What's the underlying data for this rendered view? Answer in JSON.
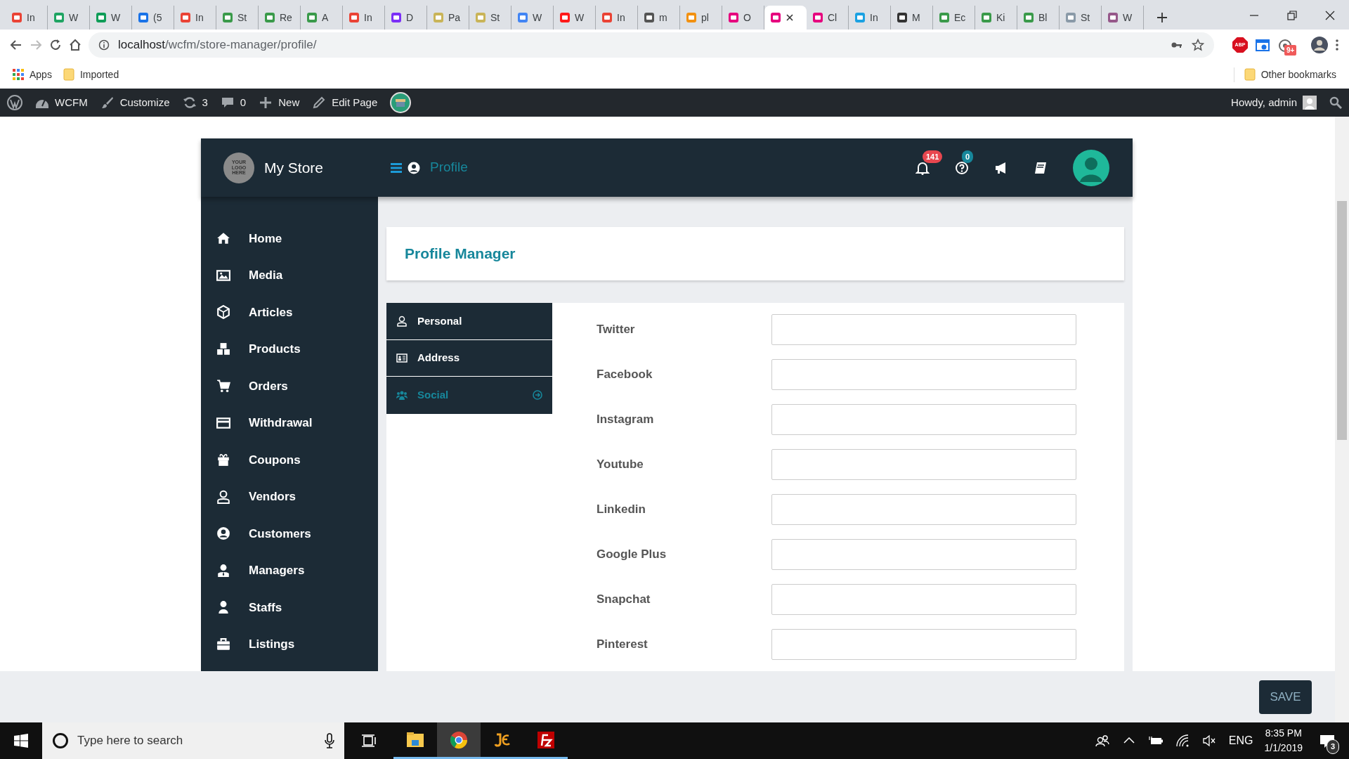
{
  "browser": {
    "tabs": [
      {
        "title": "In",
        "color": "#ea4335",
        "selected": false
      },
      {
        "title": "W",
        "color": "#1fa463",
        "selected": false
      },
      {
        "title": "W",
        "color": "#0f9d58",
        "selected": false
      },
      {
        "title": "(5",
        "color": "#1a73e8",
        "selected": false
      },
      {
        "title": "In",
        "color": "#ea4335",
        "selected": false
      },
      {
        "title": "St",
        "color": "#3a9a4a",
        "selected": false
      },
      {
        "title": "Re",
        "color": "#3a9a4a",
        "selected": false
      },
      {
        "title": "A",
        "color": "#3a9a4a",
        "selected": false
      },
      {
        "title": "In",
        "color": "#ea4335",
        "selected": false
      },
      {
        "title": "D",
        "color": "#7b2ff7",
        "selected": false
      },
      {
        "title": "Pa",
        "color": "#c9b458",
        "selected": false
      },
      {
        "title": "St",
        "color": "#c9b458",
        "selected": false
      },
      {
        "title": "W",
        "color": "#4285f4",
        "selected": false
      },
      {
        "title": "W",
        "color": "#ff1a1a",
        "selected": false
      },
      {
        "title": "In",
        "color": "#ea4335",
        "selected": false
      },
      {
        "title": "m",
        "color": "#555555",
        "selected": false
      },
      {
        "title": "pl",
        "color": "#f29111",
        "selected": false
      },
      {
        "title": "O",
        "color": "#e6007e",
        "selected": false
      },
      {
        "color": "#e6007e",
        "selected": true
      },
      {
        "title": "Cl",
        "color": "#e6007e",
        "selected": false
      },
      {
        "title": "In",
        "color": "#1ba1e2",
        "selected": false
      },
      {
        "title": "M",
        "color": "#333333",
        "selected": false
      },
      {
        "title": "Ec",
        "color": "#3a9a4a",
        "selected": false
      },
      {
        "title": "Ki",
        "color": "#3a9a4a",
        "selected": false
      },
      {
        "title": "Bl",
        "color": "#3a9a4a",
        "selected": false
      },
      {
        "title": "St",
        "color": "#8a9aa8",
        "selected": false
      },
      {
        "title": "W",
        "color": "#96588a",
        "selected": false
      }
    ],
    "url": {
      "host": "localhost",
      "path": "/wcfm/store-manager/profile/"
    },
    "abp_label": "ABP",
    "extension_badge": "9+",
    "bookmarks": [
      {
        "label": "Apps"
      },
      {
        "label": "Imported"
      }
    ],
    "other_bookmarks": "Other bookmarks"
  },
  "admin_bar": {
    "items": [
      {
        "label": "WCFM"
      },
      {
        "label": "Customize"
      },
      {
        "label": "3"
      },
      {
        "label": "0"
      },
      {
        "label": "New"
      },
      {
        "label": "Edit Page"
      }
    ],
    "greeting": "Howdy, admin"
  },
  "store": {
    "logo_text": "YOUR LOGO HERE",
    "name": "My Store",
    "breadcrumb": "Profile",
    "notifications": "141",
    "help_count": "0"
  },
  "sidebar": {
    "items": [
      {
        "label": "Home"
      },
      {
        "label": "Media"
      },
      {
        "label": "Articles"
      },
      {
        "label": "Products"
      },
      {
        "label": "Orders"
      },
      {
        "label": "Withdrawal"
      },
      {
        "label": "Coupons"
      },
      {
        "label": "Vendors"
      },
      {
        "label": "Customers"
      },
      {
        "label": "Managers"
      },
      {
        "label": "Staffs"
      },
      {
        "label": "Listings"
      }
    ]
  },
  "page": {
    "title": "Profile Manager",
    "tabs": [
      {
        "label": "Personal",
        "selected": false
      },
      {
        "label": "Address",
        "selected": false
      },
      {
        "label": "Social",
        "selected": true
      }
    ],
    "fields": [
      {
        "label": "Twitter"
      },
      {
        "label": "Facebook"
      },
      {
        "label": "Instagram"
      },
      {
        "label": "Youtube"
      },
      {
        "label": "Linkedin"
      },
      {
        "label": "Google Plus"
      },
      {
        "label": "Snapchat"
      },
      {
        "label": "Pinterest"
      }
    ]
  },
  "save_button": "SAVE",
  "taskbar": {
    "search_placeholder": "Type here to search",
    "apps": [
      {
        "selected": false
      },
      {
        "selected": true
      },
      {
        "selected": false
      },
      {
        "selected": false
      }
    ],
    "language": "ENG",
    "time": "8:35 PM",
    "date": "1/1/2019",
    "notification_count": "3"
  }
}
